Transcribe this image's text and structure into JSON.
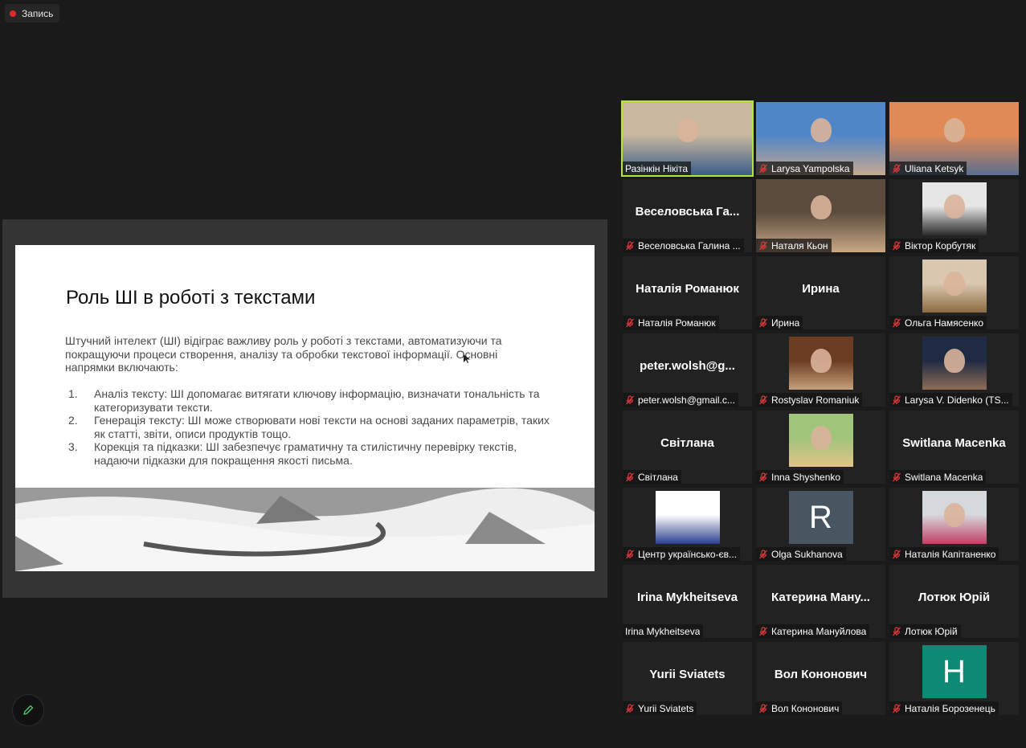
{
  "recording": {
    "label": "Запись"
  },
  "slide": {
    "title": "Роль ШІ в роботі з текстами",
    "intro": "Штучний інтелект (ШІ) відіграє важливу роль у роботі з текстами, автоматизуючи та покращуючи процеси створення, аналізу та обробки текстової інформації. Основні напрямки включають:",
    "items": [
      {
        "num": "1.",
        "text": "Аналіз тексту: ШІ допомагає витягати ключову інформацію, визначати тональність та категоризувати тексти."
      },
      {
        "num": "2.",
        "text": "Генерація тексту: ШІ може створювати нові тексти на основі заданих параметрів, таких як статті, звіти, описи продуктів тощо."
      },
      {
        "num": "3.",
        "text": "Корекція та підказки: ШІ забезпечує граматичну та стилістичну перевірку текстів, надаючи підказки для покращення якості письма."
      }
    ]
  },
  "participants": [
    {
      "label": "Разінкін Нікіта",
      "muted": false,
      "display": "photo",
      "active": true
    },
    {
      "label": "Larysa Yampolska",
      "muted": true,
      "display": "photo"
    },
    {
      "label": "Uliana Ketsyk",
      "muted": true,
      "display": "photo"
    },
    {
      "label": "Веселовська Галина ...",
      "center": "Веселовська  Га...",
      "muted": true,
      "display": "name"
    },
    {
      "label": "Наталя Кьон",
      "muted": true,
      "display": "photo"
    },
    {
      "label": "Віктор Корбутяк",
      "muted": true,
      "display": "photo"
    },
    {
      "label": "Наталія Романюк",
      "center": "Наталія  Романюк",
      "muted": true,
      "display": "name"
    },
    {
      "label": "Ирина",
      "center": "Ирина",
      "muted": true,
      "display": "name"
    },
    {
      "label": "Ольга Намясенко",
      "muted": true,
      "display": "photo"
    },
    {
      "label": "peter.wolsh@gmail.c...",
      "center": "peter.wolsh@g...",
      "muted": true,
      "display": "name"
    },
    {
      "label": "Rostyslav Romaniuk",
      "muted": true,
      "display": "photo"
    },
    {
      "label": "Larysa V. Didenko (TS...",
      "muted": true,
      "display": "photo"
    },
    {
      "label": "Світлана",
      "center": "Світлана",
      "muted": true,
      "display": "name"
    },
    {
      "label": "Inna Shyshenko",
      "muted": true,
      "display": "photo"
    },
    {
      "label": "Switlana Macenka",
      "center": "Switlana Macenka",
      "muted": true,
      "display": "name"
    },
    {
      "label": "Центр українсько-єв...",
      "muted": true,
      "display": "photo"
    },
    {
      "label": "Olga Sukhanova",
      "letter": "R",
      "avatar_color": "#475660",
      "muted": true,
      "display": "letter"
    },
    {
      "label": "Наталія Капітаненко",
      "muted": true,
      "display": "photo"
    },
    {
      "label": "Irina Mykheitseva",
      "center": "Irina Mykheitseva",
      "muted": false,
      "display": "name"
    },
    {
      "label": "Катерина Мануйлова",
      "center": "Катерина  Ману...",
      "muted": true,
      "display": "name"
    },
    {
      "label": "Лотюк Юрій",
      "center": "Лотюк Юрій",
      "muted": true,
      "display": "name"
    },
    {
      "label": "Yurii Sviatets",
      "center": "Yurii Sviatets",
      "muted": true,
      "display": "name"
    },
    {
      "label": "Вол Кононович",
      "center": "Вол Кононович",
      "muted": true,
      "display": "name"
    },
    {
      "label": "Наталія Борозенець",
      "letter": "H",
      "avatar_color": "#0e8a74",
      "muted": true,
      "display": "letter"
    }
  ],
  "colors": {
    "active_border": "#b4e33d",
    "mic_off": "#e03a3a",
    "record": "#e02828"
  },
  "icons": {
    "mic_off": "mic-off-icon",
    "pen": "pen-icon",
    "record": "record-dot-icon"
  }
}
